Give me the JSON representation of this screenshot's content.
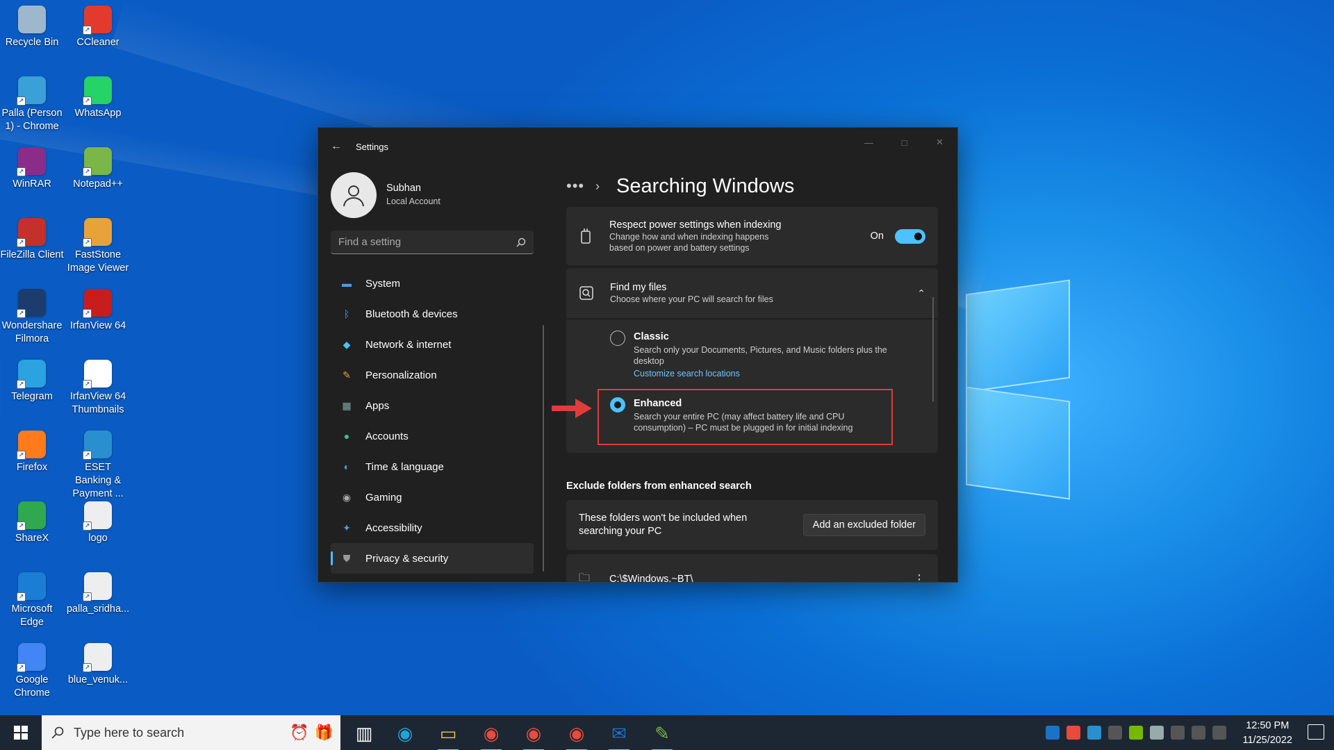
{
  "desktop": {
    "col1": [
      "Recycle Bin",
      "Palla (Person 1) - Chrome",
      "WinRAR",
      "FileZilla Client",
      "Wondershare Filmora",
      "Telegram",
      "Firefox",
      "ShareX",
      "Microsoft Edge",
      "Google Chrome"
    ],
    "col2": [
      "CCleaner",
      "WhatsApp",
      "Notepad++",
      "FastStone Image Viewer",
      "IrfanView 64",
      "IrfanView 64 Thumbnails",
      "ESET Banking & Payment ...",
      "logo",
      "palla_sridha...",
      "blue_venuk..."
    ]
  },
  "window": {
    "title": "Settings",
    "user": {
      "name": "Subhan",
      "account": "Local Account"
    },
    "search_placeholder": "Find a setting",
    "nav": [
      "System",
      "Bluetooth & devices",
      "Network & internet",
      "Personalization",
      "Apps",
      "Accounts",
      "Time & language",
      "Gaming",
      "Accessibility",
      "Privacy & security"
    ],
    "active_nav": "Privacy & security",
    "breadcrumb_more": "•••",
    "page_title": "Searching Windows",
    "power": {
      "title": "Respect power settings when indexing",
      "desc1": "Change how and when indexing happens",
      "desc2": "based on power and battery settings",
      "state": "On"
    },
    "find_files": {
      "title": "Find my files",
      "desc": "Choose where your PC will search for files"
    },
    "classic": {
      "title": "Classic",
      "desc1": "Search only your Documents, Pictures, and Music folders plus the",
      "desc2": "desktop",
      "link": "Customize search locations"
    },
    "enhanced": {
      "title": "Enhanced",
      "desc1": "Search your entire PC (may affect battery life and CPU",
      "desc2": "consumption) – PC must be plugged in for initial indexing",
      "selected": true
    },
    "exclude": {
      "heading": "Exclude folders from enhanced search",
      "desc1": "These folders won't be included when",
      "desc2": "searching your PC",
      "button": "Add an excluded folder",
      "folder": "C:\\$Windows.~BT\\"
    }
  },
  "taskbar": {
    "search_placeholder": "Type here to search",
    "time": "12:50 PM",
    "date": "11/25/2022"
  },
  "colors": {
    "accent": "#4cc2ff",
    "highlight": "#e03c3c"
  }
}
